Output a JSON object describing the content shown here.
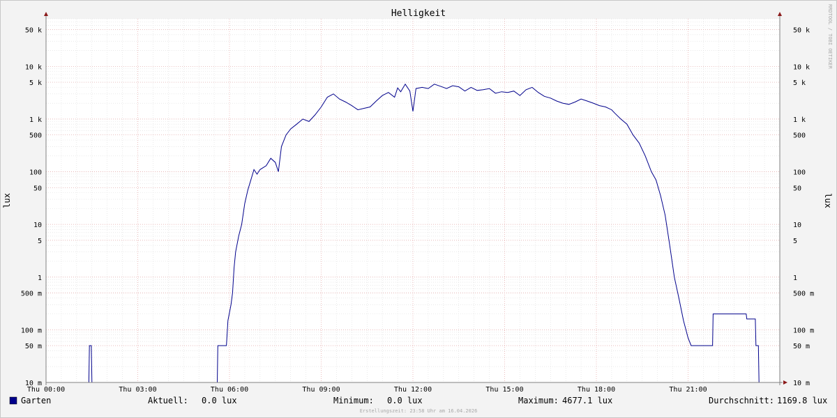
{
  "chart_data": {
    "type": "line",
    "title": "Helligkeit",
    "ylabel_left": "lux",
    "ylabel_right": "lux",
    "y_scale": "log",
    "ylim": [
      0.01,
      80000
    ],
    "xlim_hours": [
      0,
      24
    ],
    "grid": true,
    "watermark": "RRDTOOL / TOBI OETIKER",
    "x_ticks": [
      {
        "hour": 0,
        "label": "Thu 00:00"
      },
      {
        "hour": 3,
        "label": "Thu 03:00"
      },
      {
        "hour": 6,
        "label": "Thu 06:00"
      },
      {
        "hour": 9,
        "label": "Thu 09:00"
      },
      {
        "hour": 12,
        "label": "Thu 12:00"
      },
      {
        "hour": 15,
        "label": "Thu 15:00"
      },
      {
        "hour": 18,
        "label": "Thu 18:00"
      },
      {
        "hour": 21,
        "label": "Thu 21:00"
      }
    ],
    "y_ticks": [
      {
        "value": 50000,
        "label": "50 k"
      },
      {
        "value": 10000,
        "label": "10 k"
      },
      {
        "value": 5000,
        "label": "5 k"
      },
      {
        "value": 1000,
        "label": "1 k"
      },
      {
        "value": 500,
        "label": "500"
      },
      {
        "value": 100,
        "label": "100"
      },
      {
        "value": 50,
        "label": "50"
      },
      {
        "value": 10,
        "label": "10"
      },
      {
        "value": 5,
        "label": "5"
      },
      {
        "value": 1,
        "label": "1"
      },
      {
        "value": 0.5,
        "label": "500 m"
      },
      {
        "value": 0.1,
        "label": "100 m"
      },
      {
        "value": 0.05,
        "label": "50 m"
      },
      {
        "value": 0.01,
        "label": "10 m"
      }
    ],
    "series": [
      {
        "name": "Garten",
        "color": "#00008B",
        "points": [
          [
            0.0,
            0.01
          ],
          [
            1.4,
            0.01
          ],
          [
            1.42,
            0.05
          ],
          [
            1.48,
            0.05
          ],
          [
            1.5,
            0.01
          ],
          [
            5.6,
            0.01
          ],
          [
            5.62,
            0.05
          ],
          [
            5.9,
            0.05
          ],
          [
            5.95,
            0.15
          ],
          [
            6.05,
            0.3
          ],
          [
            6.1,
            0.5
          ],
          [
            6.15,
            1.5
          ],
          [
            6.2,
            3
          ],
          [
            6.3,
            6
          ],
          [
            6.4,
            10
          ],
          [
            6.5,
            25
          ],
          [
            6.6,
            45
          ],
          [
            6.7,
            70
          ],
          [
            6.8,
            110
          ],
          [
            6.9,
            90
          ],
          [
            7.0,
            110
          ],
          [
            7.2,
            130
          ],
          [
            7.35,
            180
          ],
          [
            7.5,
            150
          ],
          [
            7.6,
            100
          ],
          [
            7.7,
            300
          ],
          [
            7.85,
            500
          ],
          [
            8.0,
            650
          ],
          [
            8.2,
            800
          ],
          [
            8.4,
            1000
          ],
          [
            8.6,
            900
          ],
          [
            8.8,
            1200
          ],
          [
            9.0,
            1700
          ],
          [
            9.2,
            2600
          ],
          [
            9.4,
            3000
          ],
          [
            9.6,
            2400
          ],
          [
            9.8,
            2100
          ],
          [
            10.0,
            1800
          ],
          [
            10.2,
            1500
          ],
          [
            10.4,
            1600
          ],
          [
            10.6,
            1700
          ],
          [
            10.8,
            2200
          ],
          [
            11.0,
            2800
          ],
          [
            11.2,
            3200
          ],
          [
            11.4,
            2600
          ],
          [
            11.5,
            3900
          ],
          [
            11.6,
            3300
          ],
          [
            11.75,
            4600
          ],
          [
            11.9,
            3400
          ],
          [
            12.0,
            1400
          ],
          [
            12.1,
            3800
          ],
          [
            12.3,
            4000
          ],
          [
            12.5,
            3800
          ],
          [
            12.7,
            4600
          ],
          [
            12.9,
            4200
          ],
          [
            13.1,
            3800
          ],
          [
            13.3,
            4300
          ],
          [
            13.5,
            4100
          ],
          [
            13.7,
            3400
          ],
          [
            13.9,
            4000
          ],
          [
            14.1,
            3500
          ],
          [
            14.3,
            3600
          ],
          [
            14.5,
            3800
          ],
          [
            14.7,
            3100
          ],
          [
            14.9,
            3300
          ],
          [
            15.1,
            3200
          ],
          [
            15.3,
            3400
          ],
          [
            15.5,
            2800
          ],
          [
            15.7,
            3600
          ],
          [
            15.9,
            4000
          ],
          [
            16.1,
            3200
          ],
          [
            16.3,
            2700
          ],
          [
            16.5,
            2500
          ],
          [
            16.7,
            2200
          ],
          [
            16.9,
            2000
          ],
          [
            17.1,
            1900
          ],
          [
            17.3,
            2100
          ],
          [
            17.5,
            2400
          ],
          [
            17.7,
            2200
          ],
          [
            17.9,
            2000
          ],
          [
            18.1,
            1800
          ],
          [
            18.3,
            1700
          ],
          [
            18.5,
            1500
          ],
          [
            18.6,
            1300
          ],
          [
            18.8,
            1000
          ],
          [
            19.0,
            800
          ],
          [
            19.2,
            500
          ],
          [
            19.4,
            350
          ],
          [
            19.6,
            200
          ],
          [
            19.8,
            100
          ],
          [
            19.95,
            70
          ],
          [
            20.1,
            35
          ],
          [
            20.25,
            15
          ],
          [
            20.4,
            4
          ],
          [
            20.55,
            1
          ],
          [
            20.7,
            0.4
          ],
          [
            20.85,
            0.15
          ],
          [
            21.0,
            0.07
          ],
          [
            21.1,
            0.05
          ],
          [
            21.8,
            0.05
          ],
          [
            21.82,
            0.2
          ],
          [
            22.9,
            0.2
          ],
          [
            22.92,
            0.16
          ],
          [
            23.2,
            0.16
          ],
          [
            23.22,
            0.05
          ],
          [
            23.3,
            0.05
          ],
          [
            23.32,
            0.01
          ],
          [
            24.0,
            0.01
          ]
        ]
      }
    ]
  },
  "legend": {
    "series_name": "Garten",
    "swatch_color": "#00008B",
    "current_label": "Aktuell:",
    "current_value": "0.0 lux",
    "min_label": "Minimum:",
    "min_value": "0.0 lux",
    "max_label": "Maximum:",
    "max_value": "4677.1 lux",
    "avg_label": "Durchschnitt:",
    "avg_value": "1169.8 lux"
  },
  "footer": "Erstellungszeit: 23:58 Uhr am 16.04.2026"
}
